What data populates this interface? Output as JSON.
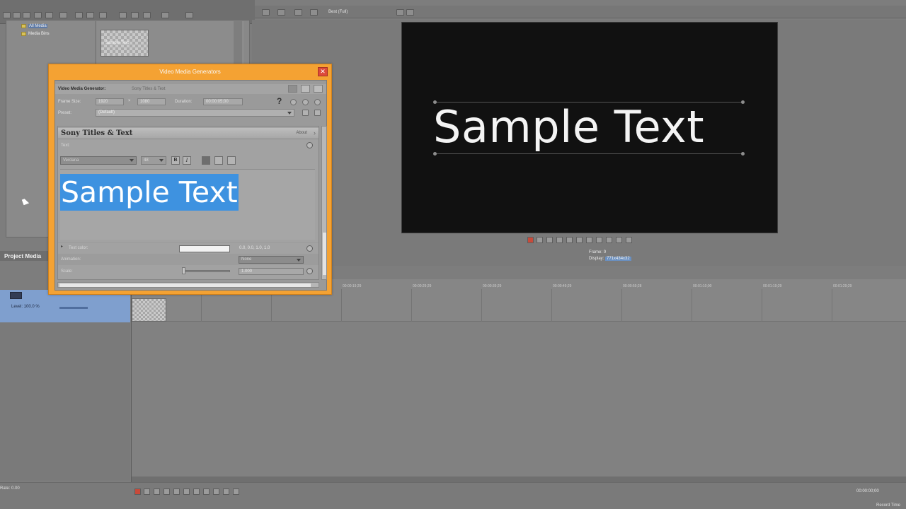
{
  "explorer": {
    "tree": [
      "All Media",
      "Media Bins"
    ],
    "tab_label": "Project Media",
    "thumbnail": "Sample Text"
  },
  "preview": {
    "quality": "Best (Full)",
    "sample_text": "Sample Text",
    "frame_label": "Frame:",
    "frame_value": "0",
    "display_label": "Display:",
    "display_value": "771x434x32"
  },
  "dialog": {
    "title": "Video Media Generators",
    "close_glyph": "✕",
    "header_label": "Video Media Generator:",
    "header_plugin": "Sony Titles & Text",
    "frame_size_label": "Frame Size:",
    "frame_width": "1920",
    "times_glyph": "×",
    "frame_height": "1080",
    "duration_label": "Duration:",
    "duration_value": "00:00:05;00",
    "preset_label": "Preset:",
    "preset_value": "(Default)",
    "help_glyph": "?",
    "plugin": {
      "name": "Sony Titles & Text",
      "about": "About",
      "about_chevron": "›",
      "text_label": "Text:",
      "font": "Verdana",
      "size": "48",
      "bold": "B",
      "italic": "I",
      "editor_text": "Sample Text",
      "textcolor_label": "Text color:",
      "textcolor_value": "0.0, 0.0, 1.0, 1.0",
      "animation_label": "Animation:",
      "animation_value": "None",
      "scale_label": "Scale:",
      "scale_value": "1.000"
    }
  },
  "track": {
    "level": "Level: 100.0 %"
  },
  "timeline": {
    "ruler": [
      "00:00:19;29",
      "00:00:29;29",
      "00:00:39;29",
      "00:00:49;29",
      "00:00:59;28",
      "00:01:10;00",
      "00:01:19;29",
      "00:01:29;29"
    ],
    "rate": "Rate: 0.00",
    "time": "00:00:00;00",
    "status": "Record Time"
  },
  "colors": {
    "dialog_frame": "#f4a233",
    "selection": "#3e92e0",
    "preview_bg": "#111111",
    "track_selected": "#7f9fce"
  },
  "icons": [
    "new-icon",
    "open-icon",
    "save-icon",
    "undo-icon",
    "zoom-icon",
    "cut-icon",
    "help-icon",
    "close-icon",
    "play-icon",
    "stop-icon",
    "loop-icon",
    "folder-icon",
    "keyframe-icon"
  ]
}
